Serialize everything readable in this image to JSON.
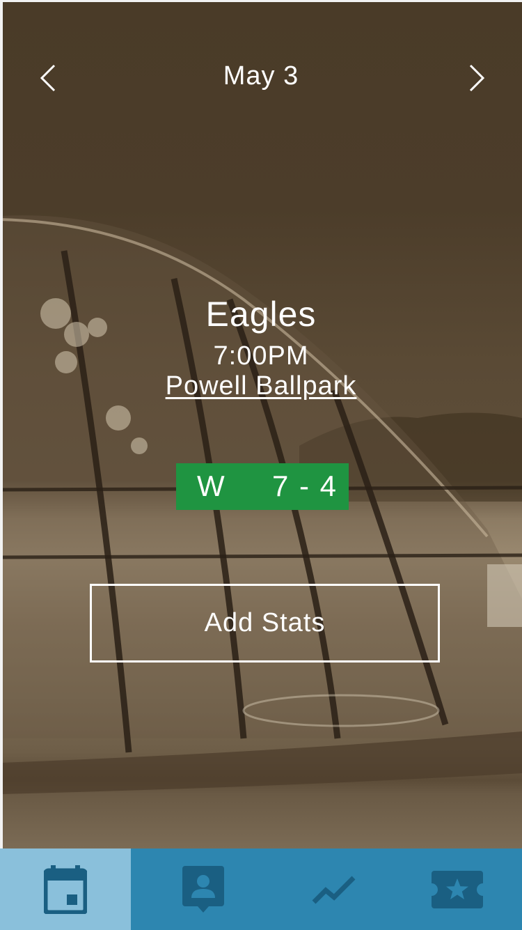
{
  "header": {
    "date": "May 3",
    "prev_icon": "chevron-left-icon",
    "next_icon": "chevron-right-icon"
  },
  "game": {
    "opponent": "Eagles",
    "time": "7:00PM",
    "venue": "Powell Ballpark"
  },
  "result": {
    "outcome": "W",
    "score": "7 - 4",
    "color": "#1f9441"
  },
  "actions": {
    "add_stats_label": "Add Stats"
  },
  "tabbar": {
    "active_index": 0,
    "colors": {
      "bar": "#2d86b0",
      "active_bg": "#8ac0db",
      "icon": "#1a5f82"
    },
    "tabs": [
      {
        "icon": "calendar-icon"
      },
      {
        "icon": "player-card-icon"
      },
      {
        "icon": "trend-chart-icon"
      },
      {
        "icon": "star-ticket-icon"
      }
    ]
  }
}
